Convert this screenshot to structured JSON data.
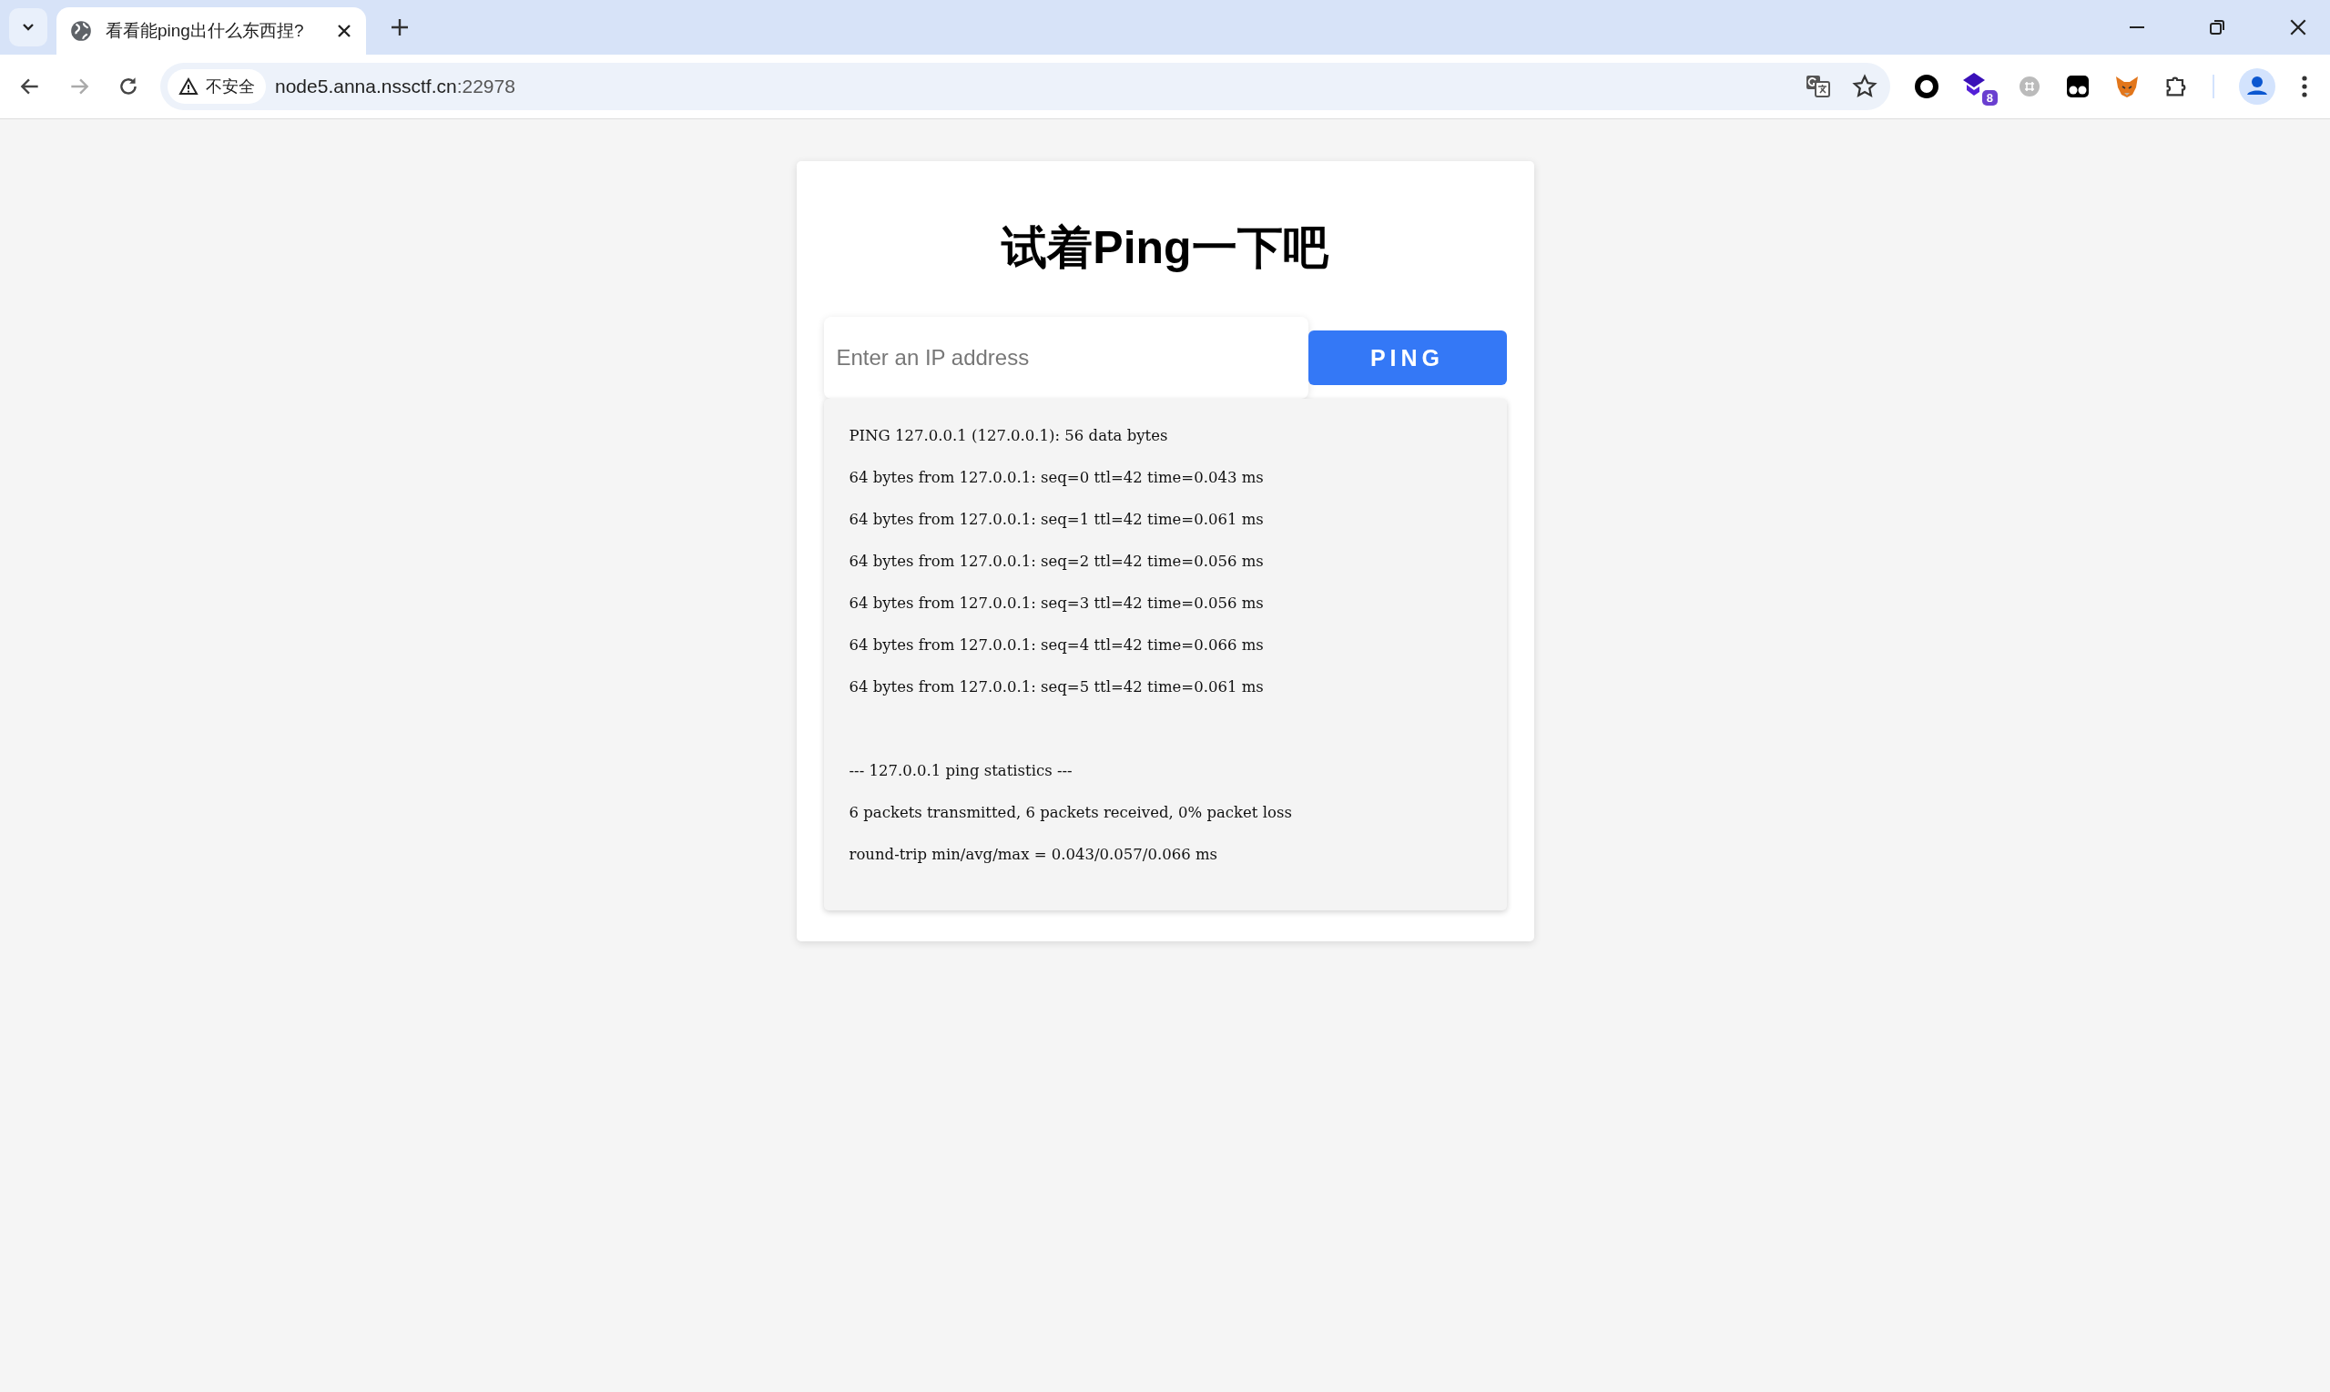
{
  "browser": {
    "tab": {
      "title": "看看能ping出什么东西捏?",
      "selected": true
    },
    "nav_buttons": [
      {
        "kind": "back",
        "disabled": false
      },
      {
        "kind": "forward",
        "disabled": true
      },
      {
        "kind": "reload",
        "disabled": false
      }
    ],
    "address_bar": {
      "security_label": "不安全",
      "url_host": "node5.anna.nssctf.cn",
      "url_port": ":22978"
    },
    "extension_badge": "8"
  },
  "page": {
    "title": "试着Ping一下吧",
    "ip_field": {
      "placeholder": "Enter an IP address"
    },
    "ping_button": "PING",
    "output": {
      "replies": [
        "PING 127.0.0.1 (127.0.0.1): 56 data bytes",
        "64 bytes from 127.0.0.1: seq=0 ttl=42 time=0.043 ms",
        "64 bytes from 127.0.0.1: seq=1 ttl=42 time=0.061 ms",
        "64 bytes from 127.0.0.1: seq=2 ttl=42 time=0.056 ms",
        "64 bytes from 127.0.0.1: seq=3 ttl=42 time=0.056 ms",
        "64 bytes from 127.0.0.1: seq=4 ttl=42 time=0.066 ms",
        "64 bytes from 127.0.0.1: seq=5 ttl=42 time=0.061 ms"
      ],
      "statistics": [
        "--- 127.0.0.1 ping statistics ---",
        "6 packets transmitted, 6 packets received, 0% packet loss",
        "round-trip min/avg/max = 0.043/0.057/0.066 ms"
      ]
    }
  }
}
